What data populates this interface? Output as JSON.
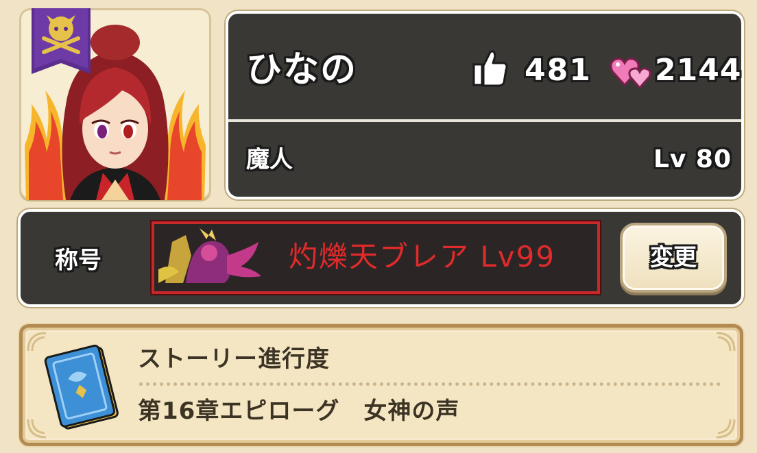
{
  "profile": {
    "name": "ひなの",
    "likes": "481",
    "hearts": "2144",
    "job": "魔人",
    "level": "Lv 80"
  },
  "title_section": {
    "label": "称号",
    "title_text": "灼爍天ブレア Lv99",
    "change_button_label": "変更"
  },
  "story": {
    "heading": "ストーリー進行度",
    "chapter": "第16章エピローグ　女神の声"
  },
  "colors": {
    "panel_bg": "#3a3835",
    "page_bg": "#f1e4c6",
    "title_red": "#e22a2a",
    "story_border": "#b38a52"
  },
  "icons": {
    "emblem": "crossed-swords-demon-emblem-icon",
    "like": "thumbs-up-icon",
    "heart": "hearts-icon",
    "book": "story-book-icon"
  }
}
